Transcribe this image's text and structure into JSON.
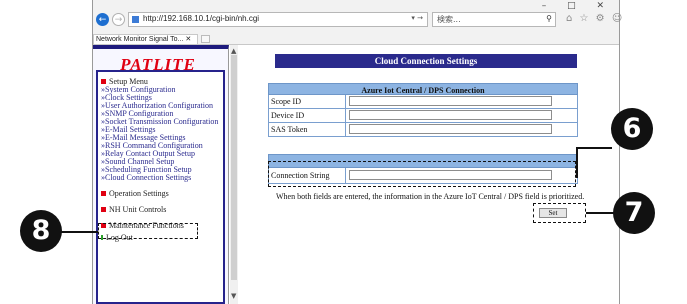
{
  "browser": {
    "window_controls": "– □ ✕",
    "url": "http://192.168.10.1/cgi-bin/nh.cgi",
    "address_controls": "▾ →",
    "search_placeholder": "検索...",
    "search_icon": "⚲",
    "toolbar_icons": "⌂ ☆ ⚙ ☺",
    "tab_title": "Network Monitor Signal To... ✕",
    "back_icon": "←",
    "forward_icon": "→"
  },
  "sidebar": {
    "logo": "PATLITE",
    "setup_heading": "Setup Menu",
    "setup_items": [
      "»System Configuration",
      "»Clock Settings",
      "»User Authorization Configuration",
      "»SNMP Configuration",
      "»Socket Transmission Configuration",
      "»E-Mail Settings",
      "»E-Mail Message Settings",
      "»RSH Command Configuration",
      "»Relay Contact Output Setup",
      "»Sound Channel Setup",
      "»Scheduling Function Setup",
      "»Cloud Connection Settings"
    ],
    "operation_heading": "Operation Settings",
    "nh_heading": "NH Unit Controls",
    "maintenance_heading": "Maintenance Functions",
    "logout": "Log Out",
    "scroll_up": "▲",
    "scroll_down": "▼"
  },
  "main": {
    "page_title": "Cloud Connection Settings",
    "azure_section_title": "Azure Iot Central / DPS Connection",
    "fields": [
      {
        "label": "Scope ID",
        "value": ""
      },
      {
        "label": "Device ID",
        "value": ""
      },
      {
        "label": "SAS Token",
        "value": ""
      }
    ],
    "connection_string": {
      "label": "Connection String",
      "value": ""
    },
    "note": "When both fields are entered, the information in the Azure IoT Central / DPS field is prioritized.",
    "set_button": "Set"
  },
  "callouts": [
    "6",
    "7",
    "8"
  ],
  "colors": {
    "title_bar": "#2a2a8c",
    "section_header": "#8db4e2",
    "logo": "#e00012",
    "link": "#2a2a8e"
  }
}
